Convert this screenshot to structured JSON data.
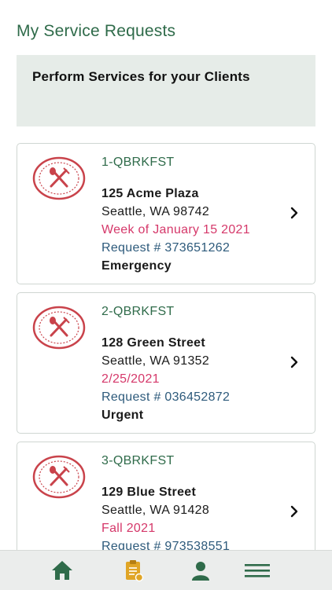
{
  "page": {
    "title": "My Service Requests"
  },
  "banner": {
    "text": "Perform Services for your Clients"
  },
  "requests": [
    {
      "code": "1-QBRKFST",
      "address1": "125 Acme Plaza",
      "address2": "Seattle, WA 98742",
      "date": "Week of January 15 2021",
      "request_no": "Request # 373651262",
      "priority": "Emergency"
    },
    {
      "code": "2-QBRKFST",
      "address1": "128 Green Street",
      "address2": "Seattle, WA 91352",
      "date": "2/25/2021",
      "request_no": "Request # 036452872",
      "priority": "Urgent"
    },
    {
      "code": "3-QBRKFST",
      "address1": "129 Blue Street",
      "address2": "Seattle, WA 91428",
      "date": "Fall 2021",
      "request_no": "Request # 973538551",
      "priority": ""
    }
  ],
  "tabbar": {
    "items": [
      {
        "icon": "home-icon"
      },
      {
        "icon": "clipboard-icon"
      },
      {
        "icon": "person-icon"
      },
      {
        "icon": "menu-icon"
      }
    ]
  },
  "colors": {
    "brand_green": "#2f6b4a",
    "date_pink": "#d5386a",
    "request_blue": "#2d5a7b",
    "icon_red": "#c9434b",
    "tab_gold": "#e0a526"
  }
}
